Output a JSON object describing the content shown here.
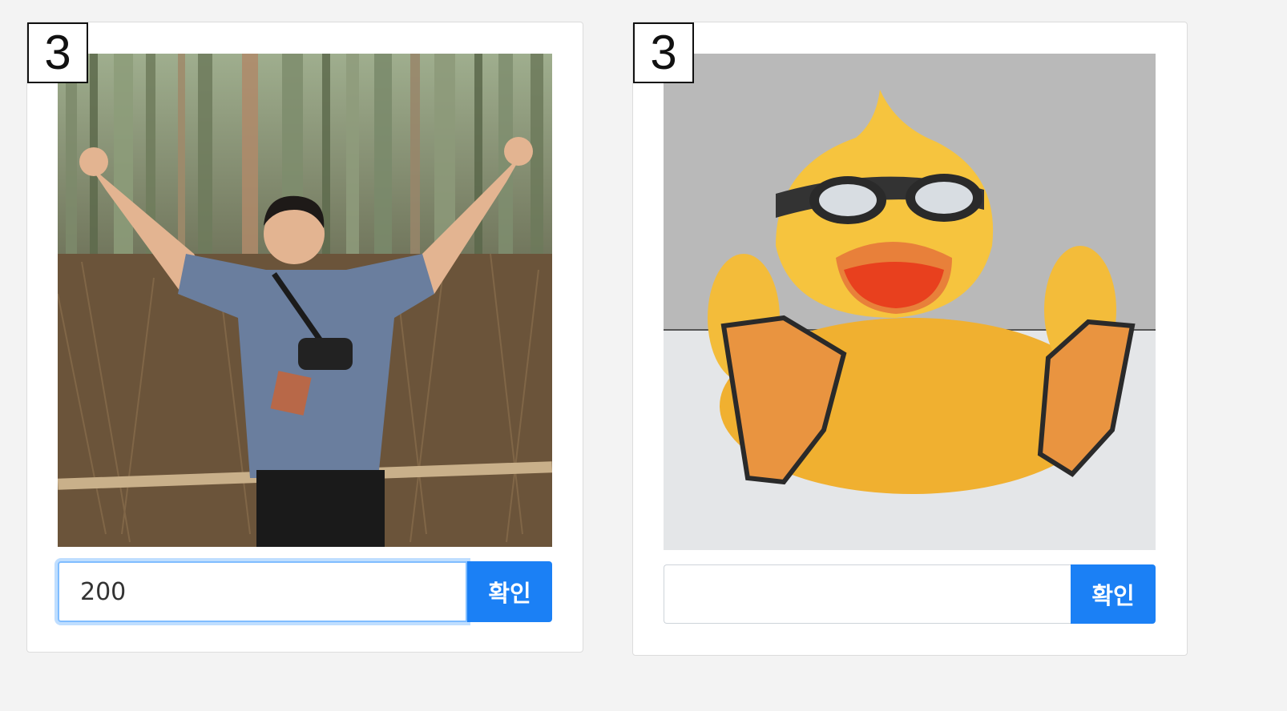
{
  "cards": [
    {
      "badge": "3",
      "image": "person-in-bamboo-forest",
      "input": {
        "value": "200",
        "placeholder": "",
        "type": "number",
        "focused": true
      },
      "button_label": "확인"
    },
    {
      "badge": "3",
      "image": "rubber-duck-with-goggles",
      "input": {
        "value": "",
        "placeholder": "",
        "type": "number",
        "focused": false
      },
      "button_label": "확인"
    }
  ],
  "colors": {
    "page_background": "#f3f3f3",
    "button_primary": "#1b80f5",
    "focus_ring": "#80bdff"
  }
}
